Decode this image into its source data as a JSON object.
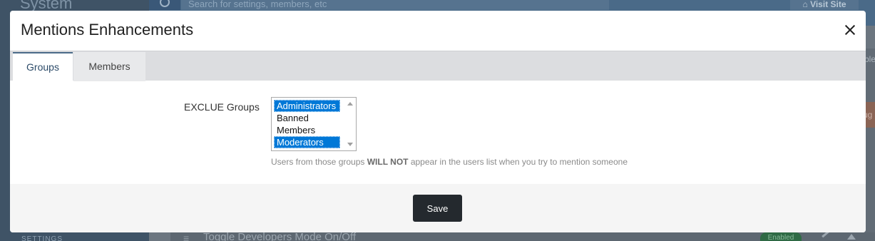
{
  "background": {
    "sidebar_title": "System",
    "sidebar_footer": "SETTINGS",
    "search_placeholder": "Search for settings, members, etc",
    "visit_site_label": "Visit Site",
    "right_text": "ble",
    "right_badge": "ug",
    "row_label": "Toggle Developers Mode On/Off",
    "row_status": "Enabled"
  },
  "modal": {
    "title": "Mentions Enhancements",
    "tabs": [
      {
        "label": "Groups"
      },
      {
        "label": "Members"
      }
    ],
    "field": {
      "label": "EXCLUE Groups",
      "options": [
        {
          "label": "Administrators",
          "selected": true
        },
        {
          "label": "Banned",
          "selected": false
        },
        {
          "label": "Members",
          "selected": false
        },
        {
          "label": "Moderators",
          "selected": true
        }
      ],
      "help_prefix": "Users from those groups ",
      "help_emphasis": "WILL NOT",
      "help_suffix": " appear in the users list when you try to mention someone"
    },
    "save_label": "Save"
  },
  "colors": {
    "selection": "#0078d7",
    "save_button": "#24292e",
    "active_tab_border": "#4a6a88"
  },
  "icons": {
    "close": "close-icon",
    "search": "search-icon",
    "home": "home-icon"
  }
}
